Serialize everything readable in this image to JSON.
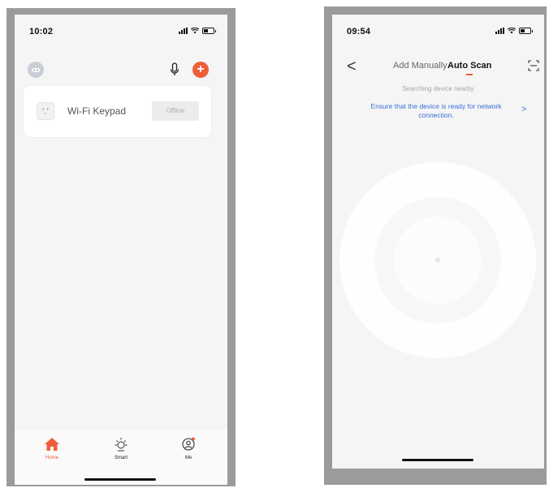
{
  "left_phone": {
    "status": {
      "time": "10:02"
    },
    "device": {
      "name": "Wi-Fi Keypad",
      "status": "Offline"
    },
    "tabbar": {
      "home": "Home",
      "smart": "Smart",
      "me": "Me"
    }
  },
  "right_phone": {
    "status": {
      "time": "09:54"
    },
    "nav": {
      "back": "<",
      "tab_manual": "Add Manually",
      "tab_auto": "Auto Scan"
    },
    "searching": "Searching device nearby",
    "ensure": "Ensure that the device is ready for network connection.",
    "ensure_arrow": ">"
  },
  "colors": {
    "accent": "#ee5d3a",
    "link": "#3a6fd8",
    "frame": "#9b9b9b"
  }
}
